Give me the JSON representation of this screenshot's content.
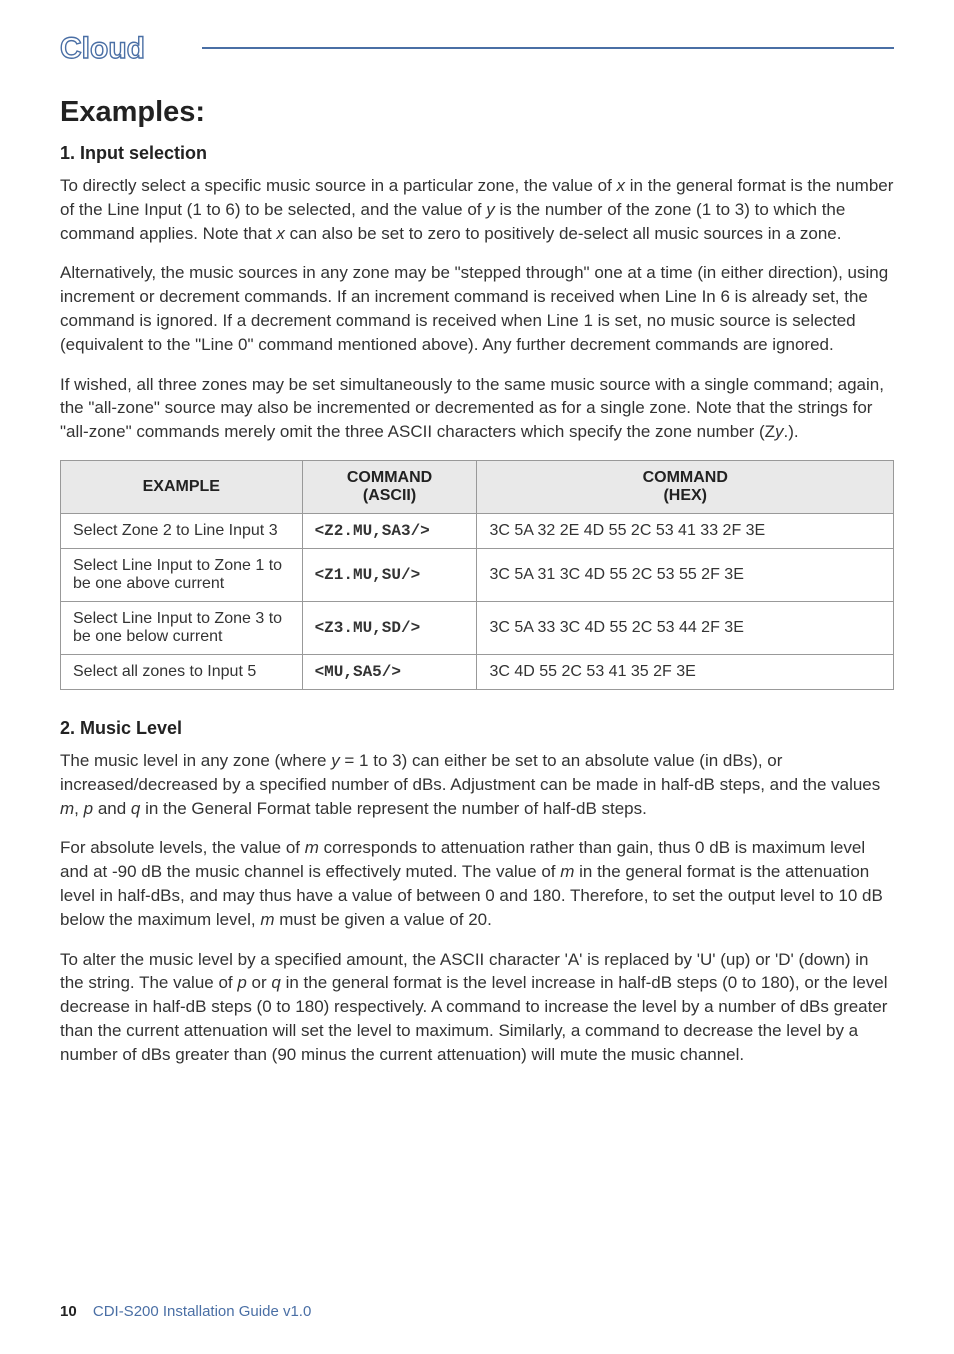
{
  "logo_text": "Cloud",
  "headings": {
    "examples": "Examples:",
    "input_selection": "1. Input selection",
    "music_level": "2. Music Level"
  },
  "paragraphs": {
    "p1a": "To directly select a specific music source in a particular zone, the value of ",
    "p1_var_x": "x",
    "p1b": " in the general format is the number of the Line Input (1 to 6) to be selected, and the value of ",
    "p1_var_y": "y",
    "p1c": " is the number of the zone (1 to 3) to which the command applies. Note that ",
    "p1_var_x2": "x",
    "p1d": " can also be set to zero to positively de-select all music sources in a zone.",
    "p2": "Alternatively, the music sources in any zone may be \"stepped through\" one at a time (in either direction), using increment or decrement commands. If an increment command is received when Line In 6 is already set, the command is ignored. If a decrement command is received when Line 1 is set, no music source is selected (equivalent to the \"Line 0\" command mentioned above). Any further decrement commands are ignored.",
    "p3a": "If wished, all three zones may be set simultaneously to the same music source with a single command; again, the \"all-zone\" source may also be incremented or decremented as for a single zone. Note that the strings for \"all-zone\" commands merely omit the three ASCII characters which specify the zone number (Z",
    "p3_var_y": "y",
    "p3b": ".).",
    "p4a": "The music level in any zone (where ",
    "p4_var_y": "y",
    "p4b": " = 1 to 3) can either be set to an absolute value (in dBs), or increased/decreased by a specified number of dBs. Adjustment can be made in half-dB steps, and the values ",
    "p4_var_m": "m",
    "p4c": ", ",
    "p4_var_p": "p",
    "p4d": " and ",
    "p4_var_q": "q",
    "p4e": " in the General Format table represent the number of half-dB steps.",
    "p5a": "For absolute levels, the value of ",
    "p5_var_m": "m",
    "p5b": " corresponds to attenuation rather than gain, thus 0 dB is maximum level and at -90 dB the music channel is effectively muted. The value of ",
    "p5_var_m2": "m",
    "p5c": " in the general format is the attenuation level in half-dBs, and may thus have a value of between 0 and 180. Therefore, to set the output level to 10 dB below the maximum level, ",
    "p5_var_m3": "m",
    "p5d": " must be given a value of 20.",
    "p6a": "To alter the music level by a specified amount, the ASCII character 'A' is replaced by 'U' (up) or 'D' (down) in the string. The value of ",
    "p6_var_p": "p",
    "p6b": " or ",
    "p6_var_q": "q",
    "p6c": " in the general format is the level increase in half-dB steps (0 to 180), or the level decrease in half-dB steps (0 to 180) respectively.  A command to increase the level by a number of dBs greater than the current attenuation will set the level to maximum. Similarly, a command to decrease the level by a number of dBs greater than (90 minus the current attenuation) will mute the music channel."
  },
  "table": {
    "headers": {
      "example": "EXAMPLE",
      "ascii_line1": "COMMAND",
      "ascii_line2": "(ASCII)",
      "hex_line1": "COMMAND",
      "hex_line2": "(HEX)"
    },
    "rows": [
      {
        "example": "Select Zone 2 to Line Input 3",
        "ascii": "<Z2.MU,SA3/>",
        "hex": "3C 5A 32 2E 4D 55 2C 53 41 33 2F 3E"
      },
      {
        "example": "Select Line Input to Zone 1 to be one above current",
        "ascii": "<Z1.MU,SU/>",
        "hex": "3C 5A 31 3C 4D 55 2C 53 55 2F 3E"
      },
      {
        "example": "Select Line Input to Zone 3 to be one below current",
        "ascii": "<Z3.MU,SD/>",
        "hex": "3C 5A 33 3C 4D 55 2C 53 44 2F 3E"
      },
      {
        "example": "Select all zones to Input 5",
        "ascii": "<MU,SA5/>",
        "hex": "3C 4D 55 2C 53 41 35 2F 3E"
      }
    ]
  },
  "footer": {
    "page_number": "10",
    "doc_title": "CDI-S200 Installation Guide v1.0"
  }
}
